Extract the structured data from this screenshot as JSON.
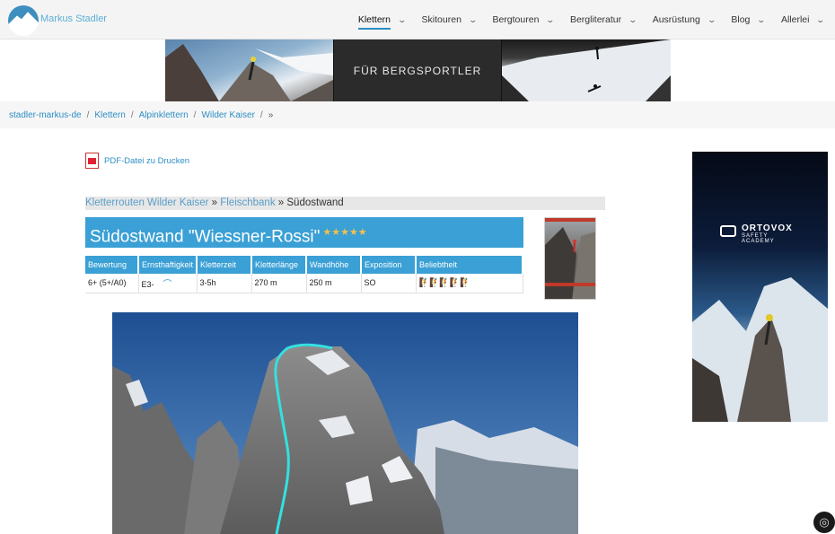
{
  "header": {
    "brand": "Markus Stadler",
    "nav": [
      {
        "label": "Klettern",
        "active": true
      },
      {
        "label": "Skitouren",
        "active": false
      },
      {
        "label": "Bergtouren",
        "active": false
      },
      {
        "label": "Bergliteratur",
        "active": false
      },
      {
        "label": "Ausrüstung",
        "active": false
      },
      {
        "label": "Blog",
        "active": false
      },
      {
        "label": "Allerlei",
        "active": false
      }
    ]
  },
  "banner": {
    "text": "FÜR BERGSPORTLER"
  },
  "breadcrumb": [
    "stadler-markus-de",
    "Klettern",
    "Alpinklettern",
    "Wilder Kaiser",
    "»"
  ],
  "pdf_link": "PDF-Datei zu Drucken",
  "subcrumb": {
    "link1": "Kletterrouten Wilder Kaiser",
    "sep1": " » ",
    "link2": "Fleischbank",
    "sep2": " » ",
    "current": "Südostwand"
  },
  "route": {
    "title": "Südostwand \"Wiessner-Rossi\"",
    "stars": "★★★★★"
  },
  "table": {
    "headers": [
      "Bewertung",
      "Ernsthaftigkeit",
      "Kletterzeit",
      "Kletterlänge",
      "Wandhöhe",
      "Exposition",
      "Beliebtheit"
    ],
    "values": [
      "6+ (5+/A0)",
      "E3-",
      "3-5h",
      "270 m",
      "250 m",
      "SO",
      "🧗🧗🧗🧗🧗"
    ]
  },
  "ad": {
    "brand": "ORTOVOX",
    "sub": "SAFETY ACADEMY"
  },
  "colors": {
    "accent": "#3aa0d5",
    "link": "#2d8ec4",
    "route_line": "#35e0e0"
  }
}
